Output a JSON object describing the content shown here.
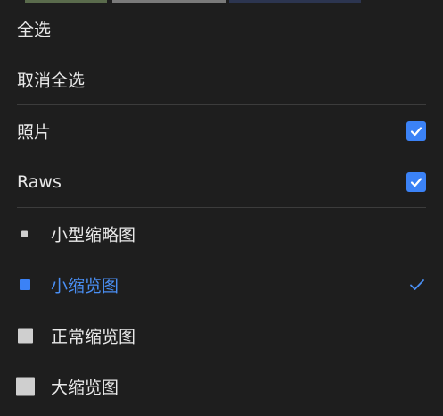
{
  "colors": {
    "background": "#1e1e1e",
    "text": "#e9e9e9",
    "accent": "#3b82f6",
    "divider": "#3c3c3c"
  },
  "menu": {
    "select_all": "全选",
    "deselect_all": "取消全选",
    "filters": [
      {
        "label": "照片",
        "checked": true,
        "icon": "checkbox-checked-icon"
      },
      {
        "label": "Raws",
        "checked": true,
        "icon": "checkbox-checked-icon"
      }
    ],
    "sizes": [
      {
        "label": "小型缩略图",
        "icon": "tiny-square-icon",
        "selected": false
      },
      {
        "label": "小缩览图",
        "icon": "small-square-icon",
        "selected": true
      },
      {
        "label": "正常缩览图",
        "icon": "medium-square-icon",
        "selected": false
      },
      {
        "label": "大缩览图",
        "icon": "large-square-icon",
        "selected": false
      }
    ],
    "selected_indicator_icon": "checkmark-icon"
  }
}
